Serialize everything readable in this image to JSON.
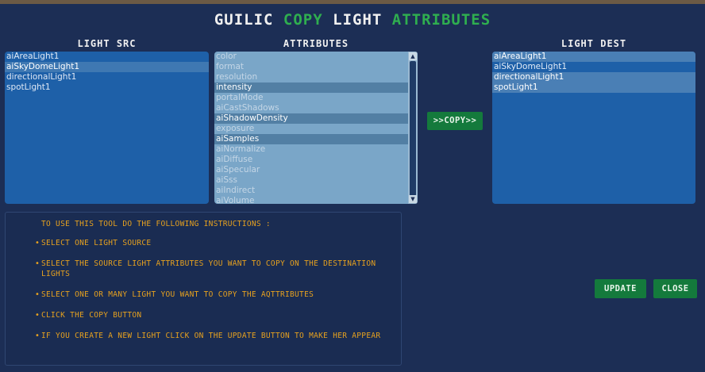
{
  "title": {
    "part1": "GUILIC",
    "part2": "COPY",
    "part3": "LIGHT",
    "part4": "ATTRIBUTES",
    "color_white": "#f0f0f0",
    "color_green": "#2fae4f"
  },
  "light_src": {
    "header": "LIGHT SRC",
    "items": [
      {
        "label": "aiAreaLight1",
        "selected": false
      },
      {
        "label": "aiSkyDomeLight1",
        "selected": true
      },
      {
        "label": "directionalLight1",
        "selected": false
      },
      {
        "label": "spotLight1",
        "selected": false
      }
    ]
  },
  "attributes": {
    "header": "ATTRIBUTES",
    "items": [
      {
        "label": "color",
        "selected": false
      },
      {
        "label": "format",
        "selected": false
      },
      {
        "label": "resolution",
        "selected": false
      },
      {
        "label": "intensity",
        "selected": true
      },
      {
        "label": "portalMode",
        "selected": false
      },
      {
        "label": "aiCastShadows",
        "selected": false
      },
      {
        "label": "aiShadowDensity",
        "selected": true
      },
      {
        "label": "exposure",
        "selected": false
      },
      {
        "label": "aiSamples",
        "selected": true
      },
      {
        "label": "aiNormalize",
        "selected": false
      },
      {
        "label": "aiDiffuse",
        "selected": false
      },
      {
        "label": "aiSpecular",
        "selected": false
      },
      {
        "label": "aiSss",
        "selected": false
      },
      {
        "label": "aiIndirect",
        "selected": false
      },
      {
        "label": "aiVolume",
        "selected": false
      }
    ]
  },
  "light_dest": {
    "header": "LIGHT DEST",
    "items": [
      {
        "label": "aiAreaLight1",
        "selected": true
      },
      {
        "label": "aiSkyDomeLight1",
        "selected": false
      },
      {
        "label": "directionalLight1",
        "selected": true
      },
      {
        "label": "spotLight1",
        "selected": true
      }
    ]
  },
  "buttons": {
    "copy": ">>COPY>>",
    "update": "UPDATE",
    "close": "CLOSE"
  },
  "instructions": {
    "heading": "TO USE THIS TOOL DO THE FOLLOWING INSTRUCTIONS :",
    "bullet": "•",
    "steps": [
      "SELECT ONE LIGHT SOURCE",
      "SELECT THE SOURCE LIGHT ATTRIBUTES YOU WANT TO COPY ON THE DESTINATION LIGHTS",
      "SELECT ONE OR MANY LIGHT YOU WANT TO COPY THE AQTTRIBUTES",
      "CLICK THE COPY BUTTON",
      "IF YOU CREATE A NEW LIGHT CLICK ON THE UPDATE BUTTON TO MAKE HER APPEAR"
    ]
  },
  "icons": {
    "scroll_up": "scroll-up-arrow-icon",
    "scroll_down": "scroll-down-arrow-icon"
  }
}
